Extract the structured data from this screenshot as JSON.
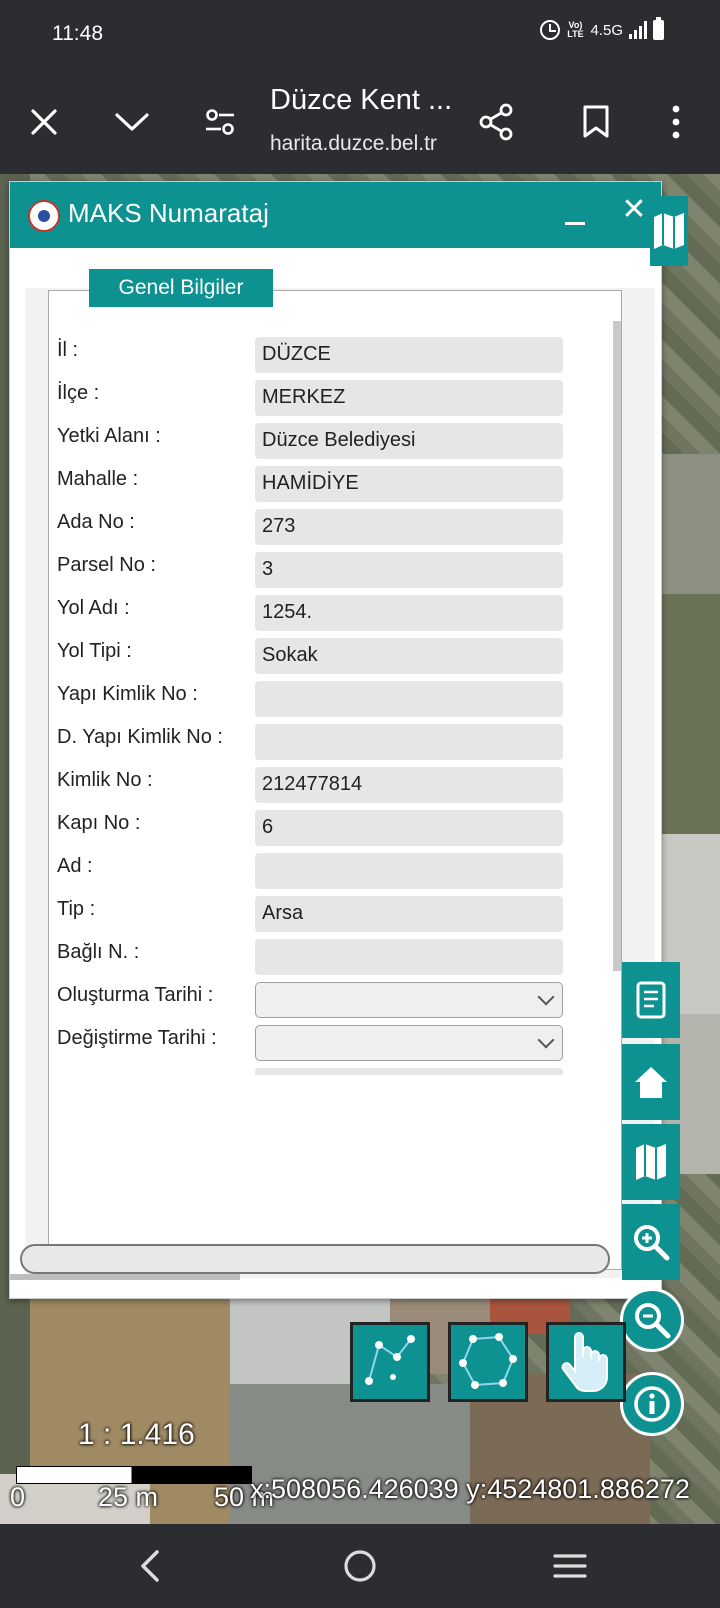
{
  "status_bar": {
    "time": "11:48",
    "network": "4.5G",
    "volte": "Vo) LTE"
  },
  "browser": {
    "title": "Düzce Kent ...",
    "url": "harita.duzce.bel.tr"
  },
  "panel": {
    "title": "MAKS Numarataj",
    "tab": "Genel Bilgiler",
    "fields": [
      {
        "label": "İl :",
        "value": "DÜZCE"
      },
      {
        "label": "İlçe :",
        "value": "MERKEZ"
      },
      {
        "label": "Yetki Alanı :",
        "value": "Düzce Belediyesi"
      },
      {
        "label": "Mahalle :",
        "value": "HAMİDİYE"
      },
      {
        "label": "Ada No :",
        "value": "273"
      },
      {
        "label": "Parsel No :",
        "value": "3"
      },
      {
        "label": "Yol Adı :",
        "value": "1254."
      },
      {
        "label": "Yol Tipi :",
        "value": "Sokak"
      },
      {
        "label": "Yapı Kimlik No :",
        "value": ""
      },
      {
        "label": "D. Yapı Kimlik No :",
        "value": ""
      },
      {
        "label": "Kimlik No :",
        "value": "212477814"
      },
      {
        "label": "Kapı No :",
        "value": "6"
      },
      {
        "label": "Ad :",
        "value": ""
      },
      {
        "label": "Tip :",
        "value": "Arsa"
      },
      {
        "label": "Bağlı N. :",
        "value": ""
      }
    ],
    "selects": [
      {
        "label": "Oluşturma Tarihi :",
        "value": ""
      },
      {
        "label": "Değiştirme Tarihi :",
        "value": ""
      }
    ]
  },
  "map": {
    "scale": "1 : 1.416",
    "scale_labels": [
      "0",
      "25 m",
      "50 m"
    ],
    "coordinates": "x:508056.426039 y:4524801.886272"
  },
  "colors": {
    "accent": "#0d9191",
    "system_bar": "#2b2d31"
  }
}
